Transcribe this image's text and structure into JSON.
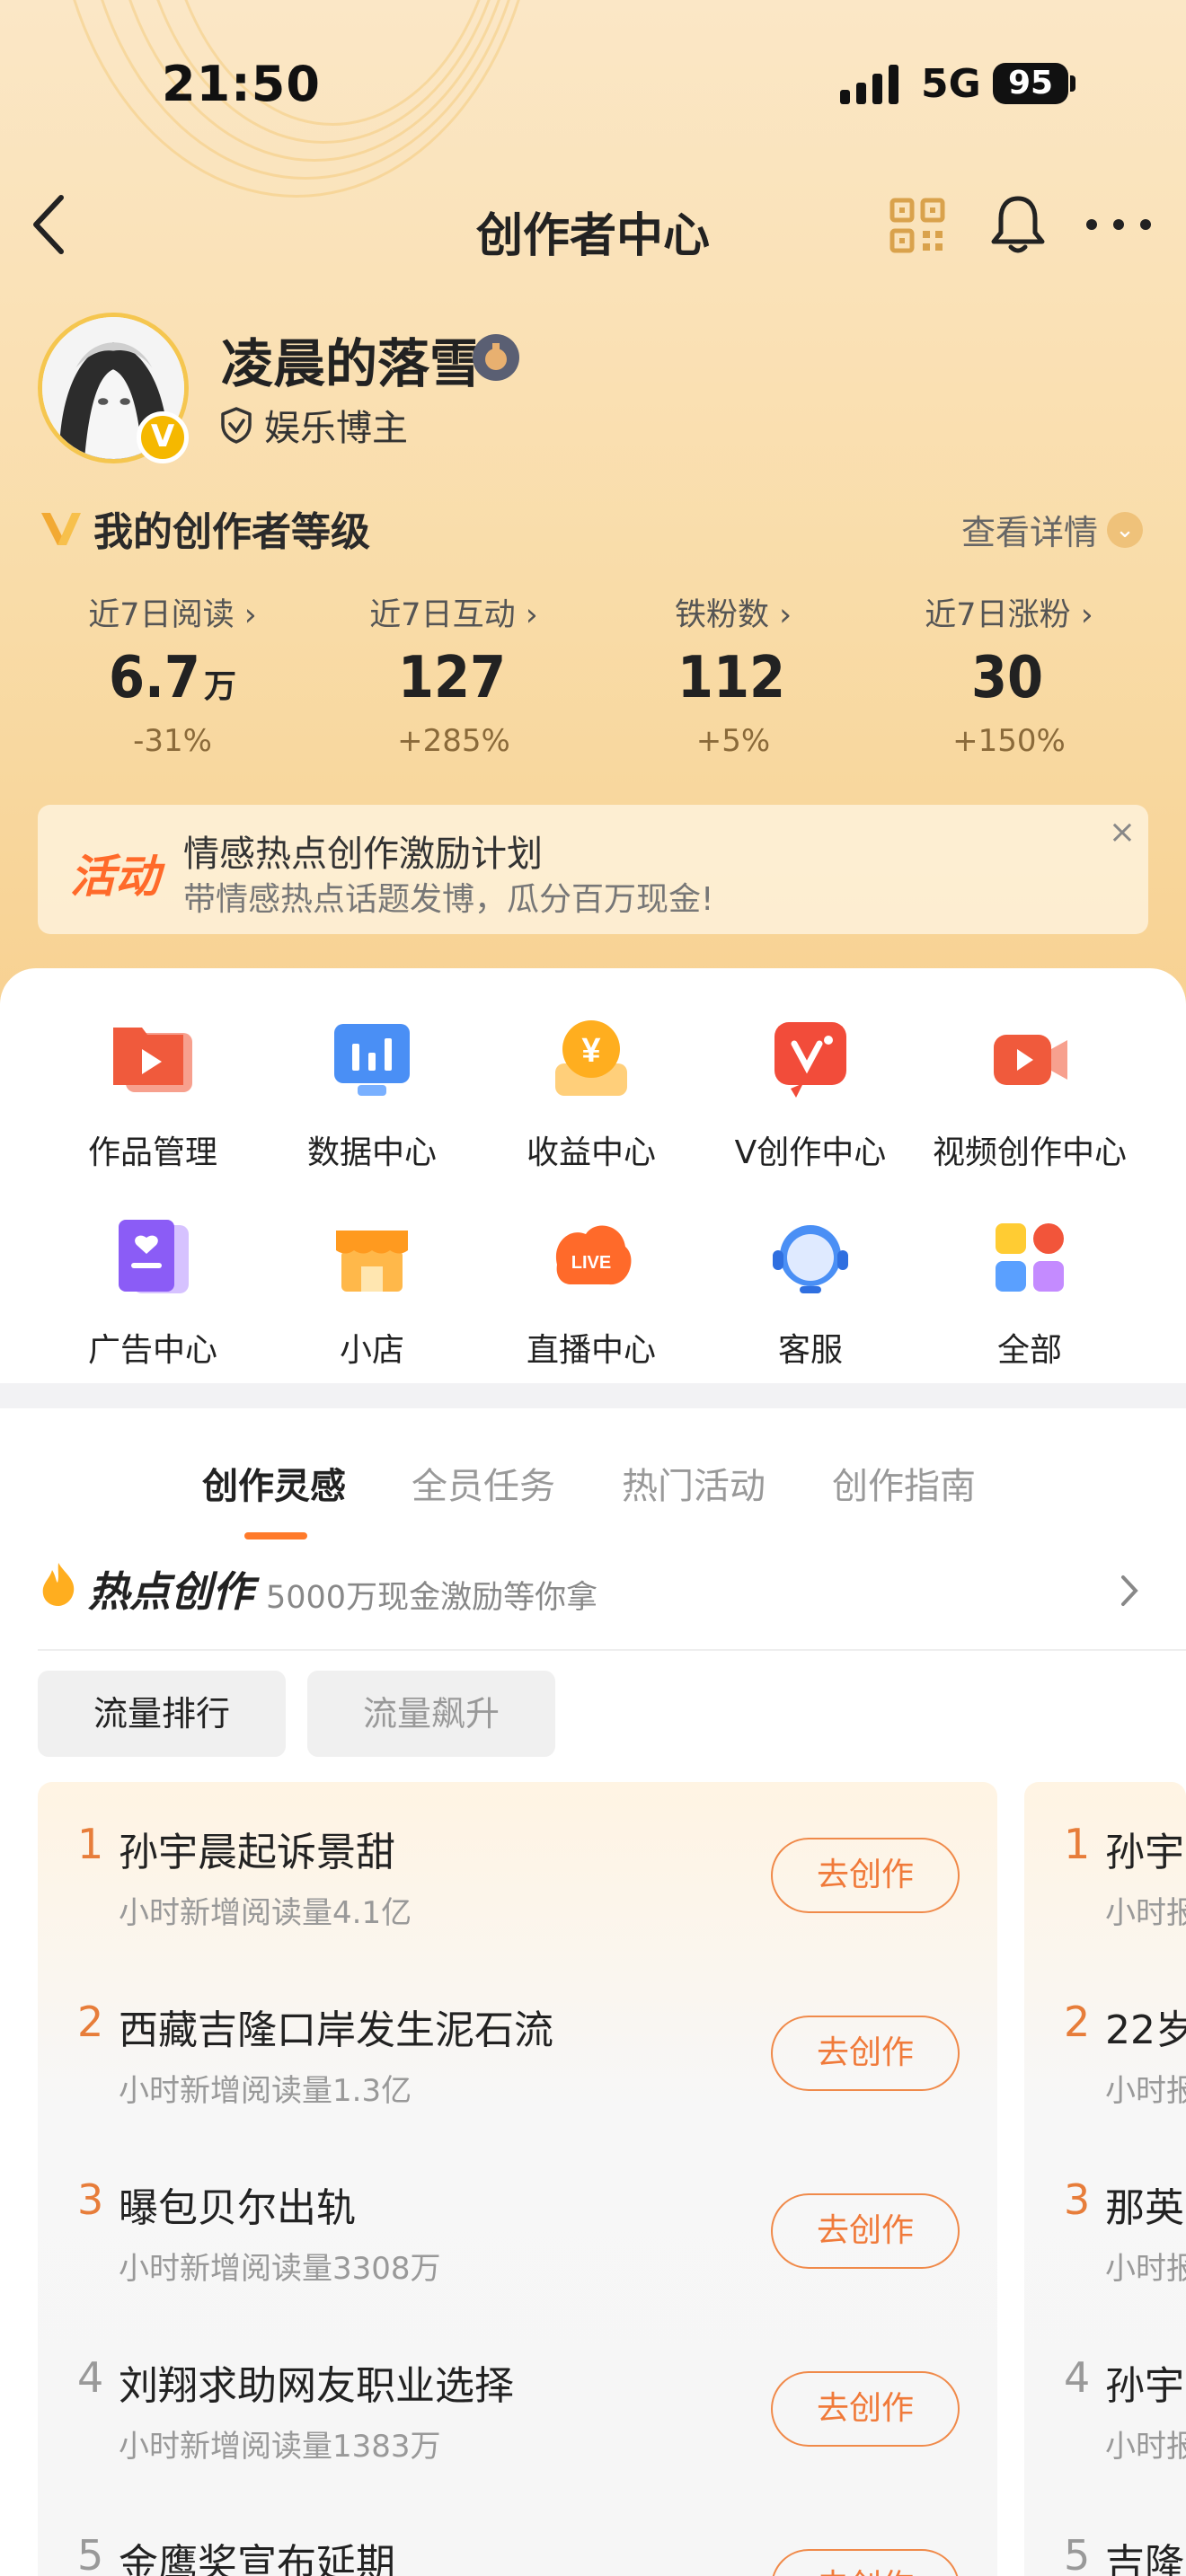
{
  "status_bar": {
    "time": "21:50",
    "network": "5G",
    "battery": "95"
  },
  "nav": {
    "title": "创作者中心"
  },
  "profile": {
    "username": "凌晨的落雪",
    "avatar_badge": "V",
    "role": "娱乐博主"
  },
  "level": {
    "title": "我的创作者等级",
    "detail_label": "查看详情",
    "detail_chevron": "⌄"
  },
  "stats": [
    {
      "label": "近7日阅读 ›",
      "value": "6.7",
      "unit": "万",
      "change": "-31%"
    },
    {
      "label": "近7日互动 ›",
      "value": "127",
      "unit": "",
      "change": "+285%"
    },
    {
      "label": "铁粉数 ›",
      "value": "112",
      "unit": "",
      "change": "+5%"
    },
    {
      "label": "近7日涨粉 ›",
      "value": "30",
      "unit": "",
      "change": "+150%"
    }
  ],
  "banner": {
    "tag": "活动",
    "title": "情感热点创作激励计划",
    "subtitle": "带情感热点话题发博，瓜分百万现金!",
    "close": "×"
  },
  "tools": [
    {
      "label": "作品管理",
      "icon": "folder-play-icon"
    },
    {
      "label": "数据中心",
      "icon": "chart-monitor-icon"
    },
    {
      "label": "收益中心",
      "icon": "yuan-coin-icon"
    },
    {
      "label": "V创作中心",
      "icon": "v-create-icon"
    },
    {
      "label": "视频创作中心",
      "icon": "video-camera-icon"
    },
    {
      "label": "广告中心",
      "icon": "ad-book-icon"
    },
    {
      "label": "小店",
      "icon": "shop-icon"
    },
    {
      "label": "直播中心",
      "icon": "live-icon"
    },
    {
      "label": "客服",
      "icon": "headset-icon"
    },
    {
      "label": "全部",
      "icon": "grid-all-icon"
    }
  ],
  "tabs": [
    "创作灵感",
    "全员任务",
    "热门活动",
    "创作指南"
  ],
  "hot": {
    "title": "热点创作",
    "subtitle": "5000万现金激励等你拿"
  },
  "filters": [
    "流量排行",
    "流量飙升"
  ],
  "ranking": [
    {
      "rank": "1",
      "title": "孙宇晨起诉景甜",
      "desc": "小时新增阅读量4.1亿",
      "action": "去创作"
    },
    {
      "rank": "2",
      "title": "西藏吉隆口岸发生泥石流",
      "desc": "小时新增阅读量1.3亿",
      "action": "去创作"
    },
    {
      "rank": "3",
      "title": "曝包贝尔出轨",
      "desc": "小时新增阅读量3308万",
      "action": "去创作"
    },
    {
      "rank": "4",
      "title": "刘翔求助网友职业选择",
      "desc": "小时新增阅读量1383万",
      "action": "去创作"
    },
    {
      "rank": "5",
      "title": "金鹰奖宣布延期",
      "desc": "",
      "action": "去创作"
    }
  ],
  "ranking_peek": [
    {
      "rank": "1",
      "title": "孙宇",
      "desc": "小时报"
    },
    {
      "rank": "2",
      "title": "22岁",
      "desc": "小时报"
    },
    {
      "rank": "3",
      "title": "那英",
      "desc": "小时报"
    },
    {
      "rank": "4",
      "title": "孙宇",
      "desc": "小时报"
    },
    {
      "rank": "5",
      "title": "吉隆",
      "desc": ""
    }
  ]
}
